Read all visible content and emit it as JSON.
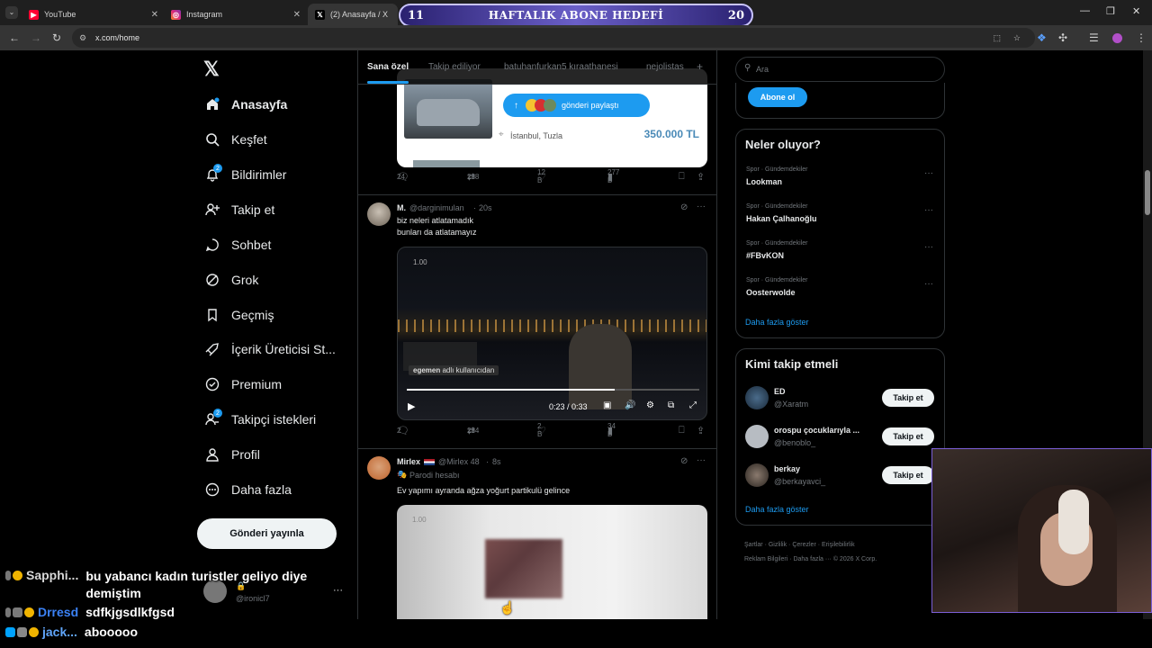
{
  "browser": {
    "tabs": [
      {
        "title": "YouTube",
        "icon": "youtube-icon"
      },
      {
        "title": "Instagram",
        "icon": "instagram-icon"
      },
      {
        "title": "(2) Anasayfa / X",
        "icon": "x-logo-icon"
      }
    ],
    "url": "x.com/home"
  },
  "goal_banner": {
    "left_num": "11",
    "title": "HAFTALIK ABONE HEDEFİ",
    "right_num": "20"
  },
  "nav": {
    "items": [
      {
        "label": "Anasayfa",
        "icon": "home-icon"
      },
      {
        "label": "Keşfet",
        "icon": "search-icon"
      },
      {
        "label": "Bildirimler",
        "icon": "bell-icon",
        "badge": "2"
      },
      {
        "label": "Takip et",
        "icon": "add-user-icon"
      },
      {
        "label": "Sohbet",
        "icon": "chat-icon"
      },
      {
        "label": "Grok",
        "icon": "grok-icon"
      },
      {
        "label": "Geçmiş",
        "icon": "bookmark-icon"
      },
      {
        "label": "İçerik Üreticisi St...",
        "icon": "rocket-icon"
      },
      {
        "label": "Premium",
        "icon": "premium-icon"
      },
      {
        "label": "Takipçi istekleri",
        "icon": "follower-requests-icon",
        "badge": "2"
      },
      {
        "label": "Profil",
        "icon": "profile-icon"
      },
      {
        "label": "Daha fazla",
        "icon": "more-icon"
      }
    ],
    "post_button": "Gönderi yayınla",
    "account_handle": "@ironicl7"
  },
  "feed": {
    "tabs": [
      "Sana özel",
      "Takip ediliyor",
      "batuhanfurkan5 kıraathanesi",
      "nejolistas"
    ],
    "listing": {
      "shared_label": "gönderi paylaştı",
      "location": "İstanbul, Tuzla",
      "price": "350.000 TL"
    },
    "post1_stats": {
      "replies": "24",
      "reposts": "258",
      "likes": "12 B",
      "views": "277 B"
    },
    "post2": {
      "name": "M.",
      "handle": "@darginimulan",
      "time": "20s",
      "text_line1": "biz neleri atlatamadık",
      "text_line2": "bunları da atlatamayız",
      "video_speed": "1.00",
      "video_overlay_user": "egemen",
      "video_overlay_suffix": "adlı kullanıcıdan",
      "video_time": "0:23 / 0:33",
      "stats": {
        "replies": "2",
        "reposts": "254",
        "likes": "2 B",
        "views": "34 B"
      }
    },
    "post3": {
      "name": "Mirlex",
      "handle": "@Mirlex 48",
      "time": "8s",
      "parody": "Parodi hesabı",
      "text": "Ev yapımı ayranda ağza yoğurt partikulü gelince",
      "video_speed": "1.00"
    }
  },
  "right": {
    "search_placeholder": "Ara",
    "subscribe_button": "Abone ol",
    "trends_title": "Neler oluyor?",
    "trends": [
      {
        "meta": "Spor · Gündemdekiler",
        "name": "Lookman"
      },
      {
        "meta": "Spor · Gündemdekiler",
        "name": "Hakan Çalhanoğlu"
      },
      {
        "meta": "Spor · Gündemdekiler",
        "name": "#FBvKON"
      },
      {
        "meta": "Spor · Gündemdekiler",
        "name": "Oosterwolde"
      }
    ],
    "show_more": "Daha fazla göster",
    "who_to_follow_title": "Kimi takip etmeli",
    "suggestions": [
      {
        "name": "ED",
        "handle": "@Xaratm",
        "button": "Takip et"
      },
      {
        "name": "orospu çocuklarıyla ...",
        "handle": "@benoblo_",
        "button": "Takip et"
      },
      {
        "name": "berkay",
        "handle": "@berkayavci_",
        "button": "Takip et"
      }
    ],
    "show_more2": "Daha fazla göster",
    "footer_line1": [
      "Şartlar",
      "Gizlilik",
      "Çerezler",
      "Erişilebilirlik"
    ],
    "footer_line2": [
      "Reklam Bilgileri",
      "Daha fazla ···",
      "© 2026 X Corp."
    ]
  },
  "chat": [
    {
      "user": "Sapphi...",
      "user_color": "#d7d7d7",
      "message_line1": "bu yabancı kadın turistler geliyo diye",
      "message_line2": "demiştim"
    },
    {
      "user": "Drresd",
      "user_color": "#3b82f6",
      "message_line1": "sdfkjgsdlkfgsd"
    },
    {
      "user": "jack...",
      "user_color": "#60a5fa",
      "message_line1": "abooooo"
    }
  ]
}
